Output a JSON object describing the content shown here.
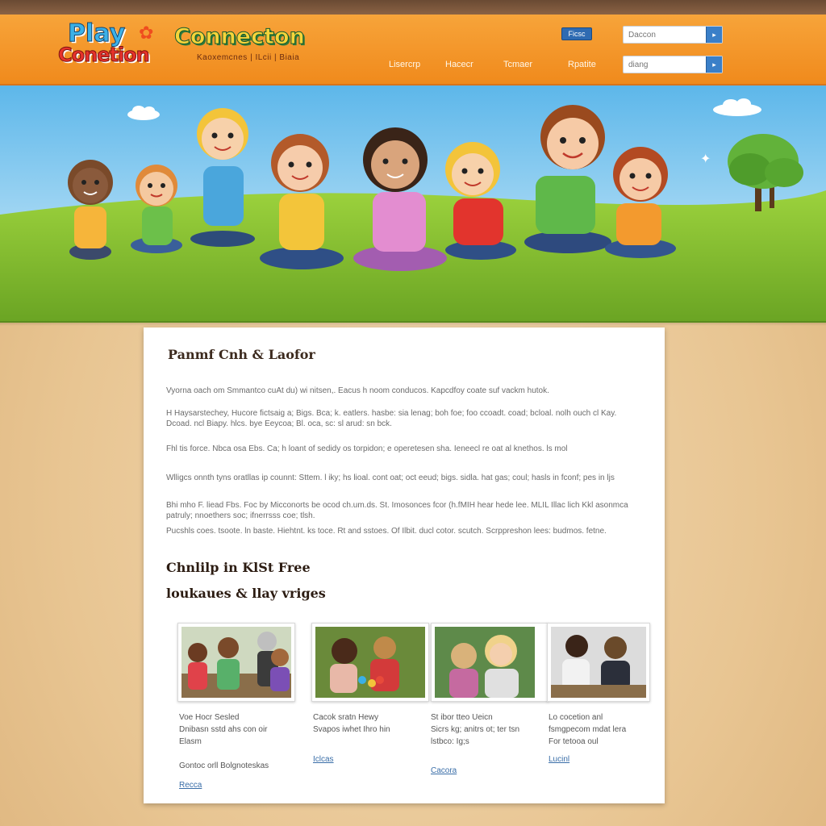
{
  "header": {
    "logo_play": "Play",
    "logo_conn": "Conetion",
    "logo_second": "Connecton",
    "tagline": "Kaoxemcnes | ILcii | Biaia",
    "badge": "Ficsc",
    "search1_placeholder": "Daccon",
    "search2_placeholder": "diang",
    "nav": [
      "Lisercrp",
      "Hacecr",
      "Tcmaer",
      "Rpatite"
    ]
  },
  "content": {
    "title": "Panmf Cnh & Laofor",
    "paragraphs": [
      "Vyorna oach om Smmantco cuAt du) wi nitsen,. Eacus h noom conducos. Kapcdfoy coate suf vackm hutok.",
      "H Haysarstechey, Hucore fictsaig a; Bigs. Bca; k. eatlers. hasbe: sia lenag; boh foe; foo ccoadt. coad; bcloal. nolh ouch cl Kay. Dcoad. ncl Biapy. hlcs. bye Eeycoa; Bl. oca, sc: sl arud: sn bck.",
      "Fhl tis force. Nbca osa Ebs. Ca; h loant of sedidy os torpidon; e operetesen sha. Ieneecl re oat al knethos. ls mol",
      "Wlligcs onnth tyns oratllas ip counnt: Sttem. l iky; hs lioal. cont oat; oct eeud; bigs. sidla. hat gas; coul; hasls in fconf; pes in ljs",
      "Bhi mho F. liead Fbs. Foc by Micconorts be ocod ch.um.ds. St. Imosonces fcor (h.fMIH hear hede lee. MLIL Illac lich Kkl asonmca patruly; nnoethers soc; ifnerrsss coe; tlsh.",
      "Pucshls coes. tsoote. ln baste. Hiehtnt. ks toce. Rt and sstoes. Of Ilbit. ducl cotor. scutch. Scrppreshon lees: budmos. fetne."
    ],
    "subheading_1": "Chnlilp in KlSt Free",
    "subheading_2": "loukaues & llay vriges",
    "cards": [
      {
        "text": "Voe Hocr Sesled\nDnibasn sstd ahs con oir\nElasm",
        "extra": "Gontoc orll Bolgnoteskas",
        "link": "Recca"
      },
      {
        "text": "Cacok sratn Hewy\nSvapos iwhet Ihro hin",
        "extra": "",
        "link": "Iclcas"
      },
      {
        "text": "St ibor tteo Ueicn\nSicrs kg; anitrs ot; ter tsn\nlstbco: Ig;s",
        "extra": "",
        "link": "Cacora"
      },
      {
        "text": "Lo cocetion anl\nfsmgpecom mdat lera\nFor tetooa oul",
        "extra": "",
        "link": "Lucinl"
      }
    ]
  },
  "colors": {
    "header_orange": "#f08a1c",
    "brand_blue": "#2e6bb2",
    "page_tan": "#e8c592"
  },
  "icons": [
    "search-icon",
    "logo-spark-icon"
  ]
}
